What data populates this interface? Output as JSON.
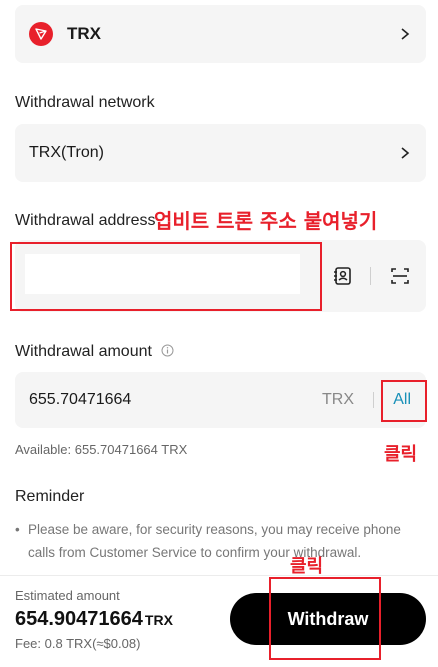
{
  "coin": {
    "name": "TRX"
  },
  "network": {
    "label": "Withdrawal network",
    "value": "TRX(Tron)"
  },
  "address": {
    "label": "Withdrawal address",
    "value": ""
  },
  "amount": {
    "label": "Withdrawal amount",
    "value": "655.70471664",
    "unit": "TRX",
    "all_label": "All"
  },
  "available": "Available: 655.70471664 TRX",
  "reminder": {
    "title": "Reminder",
    "bullet": "•",
    "text": "Please be aware, for security reasons, you may receive phone calls from Customer Service to confirm your withdrawal."
  },
  "summary": {
    "estimated_label": "Estimated amount",
    "estimated_value": "654.90471664",
    "estimated_unit": "TRX",
    "fee": "Fee: 0.8 TRX(≈$0.08)",
    "withdraw_label": "Withdraw"
  },
  "annotations": {
    "paste_address": "업비트 트론 주소 붙여넣기",
    "click_all": "클릭",
    "click_withdraw": "클릭"
  },
  "colors": {
    "annotation": "#e8202b",
    "link": "#1890b8",
    "button": "#000000"
  }
}
